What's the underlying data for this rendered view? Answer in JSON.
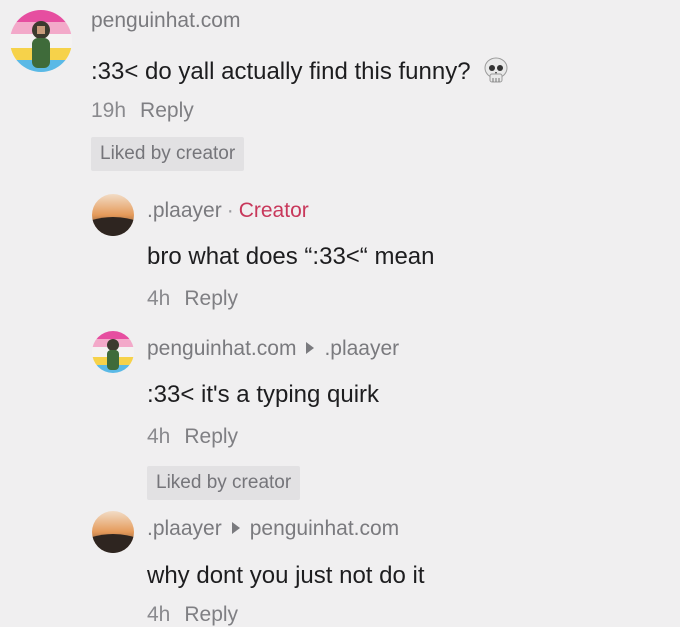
{
  "comments": [
    {
      "username": "penguinhat.com",
      "text": ":33< do yall actually find this funny?",
      "emoji": "skull-icon",
      "time": "19h",
      "reply": "Reply",
      "liked": "Liked by creator"
    },
    {
      "username": ".plaayer",
      "separator": "·",
      "creator": "Creator",
      "text": "bro what does “:33<“ mean",
      "time": "4h",
      "reply": "Reply"
    },
    {
      "username": "penguinhat.com",
      "reply_to": ".plaayer",
      "text": ":33< it's a typing quirk",
      "time": "4h",
      "reply": "Reply",
      "liked": "Liked by creator"
    },
    {
      "username": ".plaayer",
      "reply_to": "penguinhat.com",
      "text": "why dont you just not do it",
      "time": "4h",
      "reply": "Reply"
    }
  ],
  "colors": {
    "background": "#f0eff0",
    "creator_tag": "#c8385b",
    "meta": "#8a8a8e",
    "text": "#1d1d1f"
  }
}
